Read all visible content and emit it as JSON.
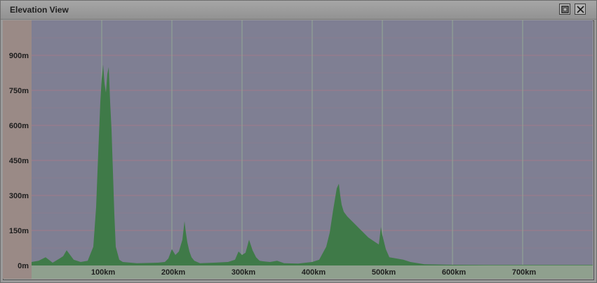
{
  "window": {
    "title": "Elevation View",
    "buttons": [
      {
        "name": "restore",
        "icon": "restore-icon"
      },
      {
        "name": "close",
        "icon": "close-icon"
      }
    ]
  },
  "colors": {
    "plot_background": "#7f7f93",
    "y_axis_strip": "#9a8a86",
    "x_axis_strip": "#8fa08e",
    "profile_fill": "#3f7a48",
    "grid_horizontal": "#a07a8a",
    "grid_vertical": "#93a896"
  },
  "chart_data": {
    "type": "area",
    "x_unit": "km",
    "y_unit": "m",
    "xlim": [
      0,
      800
    ],
    "ylim": [
      0,
      1000
    ],
    "grid": true,
    "x_ticks": [
      {
        "value": 100,
        "label": "100km"
      },
      {
        "value": 200,
        "label": "200km"
      },
      {
        "value": 300,
        "label": "300km"
      },
      {
        "value": 400,
        "label": "400km"
      },
      {
        "value": 500,
        "label": "500km"
      },
      {
        "value": 600,
        "label": "600km"
      },
      {
        "value": 700,
        "label": "700km"
      }
    ],
    "y_ticks": [
      {
        "value": 0,
        "label": "0m"
      },
      {
        "value": 150,
        "label": "150m"
      },
      {
        "value": 300,
        "label": "300m"
      },
      {
        "value": 450,
        "label": "450m"
      },
      {
        "value": 600,
        "label": "600m"
      },
      {
        "value": 750,
        "label": "750m"
      },
      {
        "value": 900,
        "label": "900m"
      }
    ],
    "series": [
      {
        "x": [
          0,
          10,
          20,
          30,
          40,
          45,
          50,
          55,
          60,
          70,
          80,
          88,
          92,
          95,
          98,
          100,
          102,
          104,
          106,
          108,
          110,
          112,
          114,
          116,
          118,
          120,
          125,
          130,
          150,
          180,
          190,
          195,
          200,
          205,
          210,
          215,
          218,
          220,
          222,
          225,
          228,
          232,
          240,
          260,
          280,
          290,
          295,
          300,
          305,
          310,
          315,
          320,
          325,
          330,
          340,
          350,
          360,
          380,
          400,
          410,
          420,
          425,
          430,
          435,
          438,
          440,
          442,
          445,
          450,
          460,
          470,
          480,
          490,
          495,
          498,
          500,
          505,
          510,
          520,
          530,
          540,
          560,
          600,
          650,
          700,
          750,
          800
        ],
        "y": [
          15,
          20,
          35,
          12,
          30,
          40,
          65,
          45,
          25,
          15,
          20,
          80,
          250,
          480,
          700,
          800,
          860,
          780,
          740,
          820,
          850,
          700,
          580,
          400,
          220,
          80,
          25,
          15,
          10,
          12,
          15,
          30,
          70,
          45,
          60,
          110,
          190,
          140,
          100,
          60,
          35,
          20,
          10,
          12,
          15,
          25,
          60,
          45,
          55,
          110,
          65,
          35,
          20,
          18,
          15,
          20,
          10,
          8,
          15,
          25,
          80,
          140,
          240,
          330,
          350,
          300,
          260,
          230,
          210,
          180,
          150,
          120,
          100,
          90,
          165,
          130,
          70,
          35,
          30,
          25,
          15,
          5,
          3,
          2,
          2,
          2,
          2
        ]
      }
    ]
  }
}
